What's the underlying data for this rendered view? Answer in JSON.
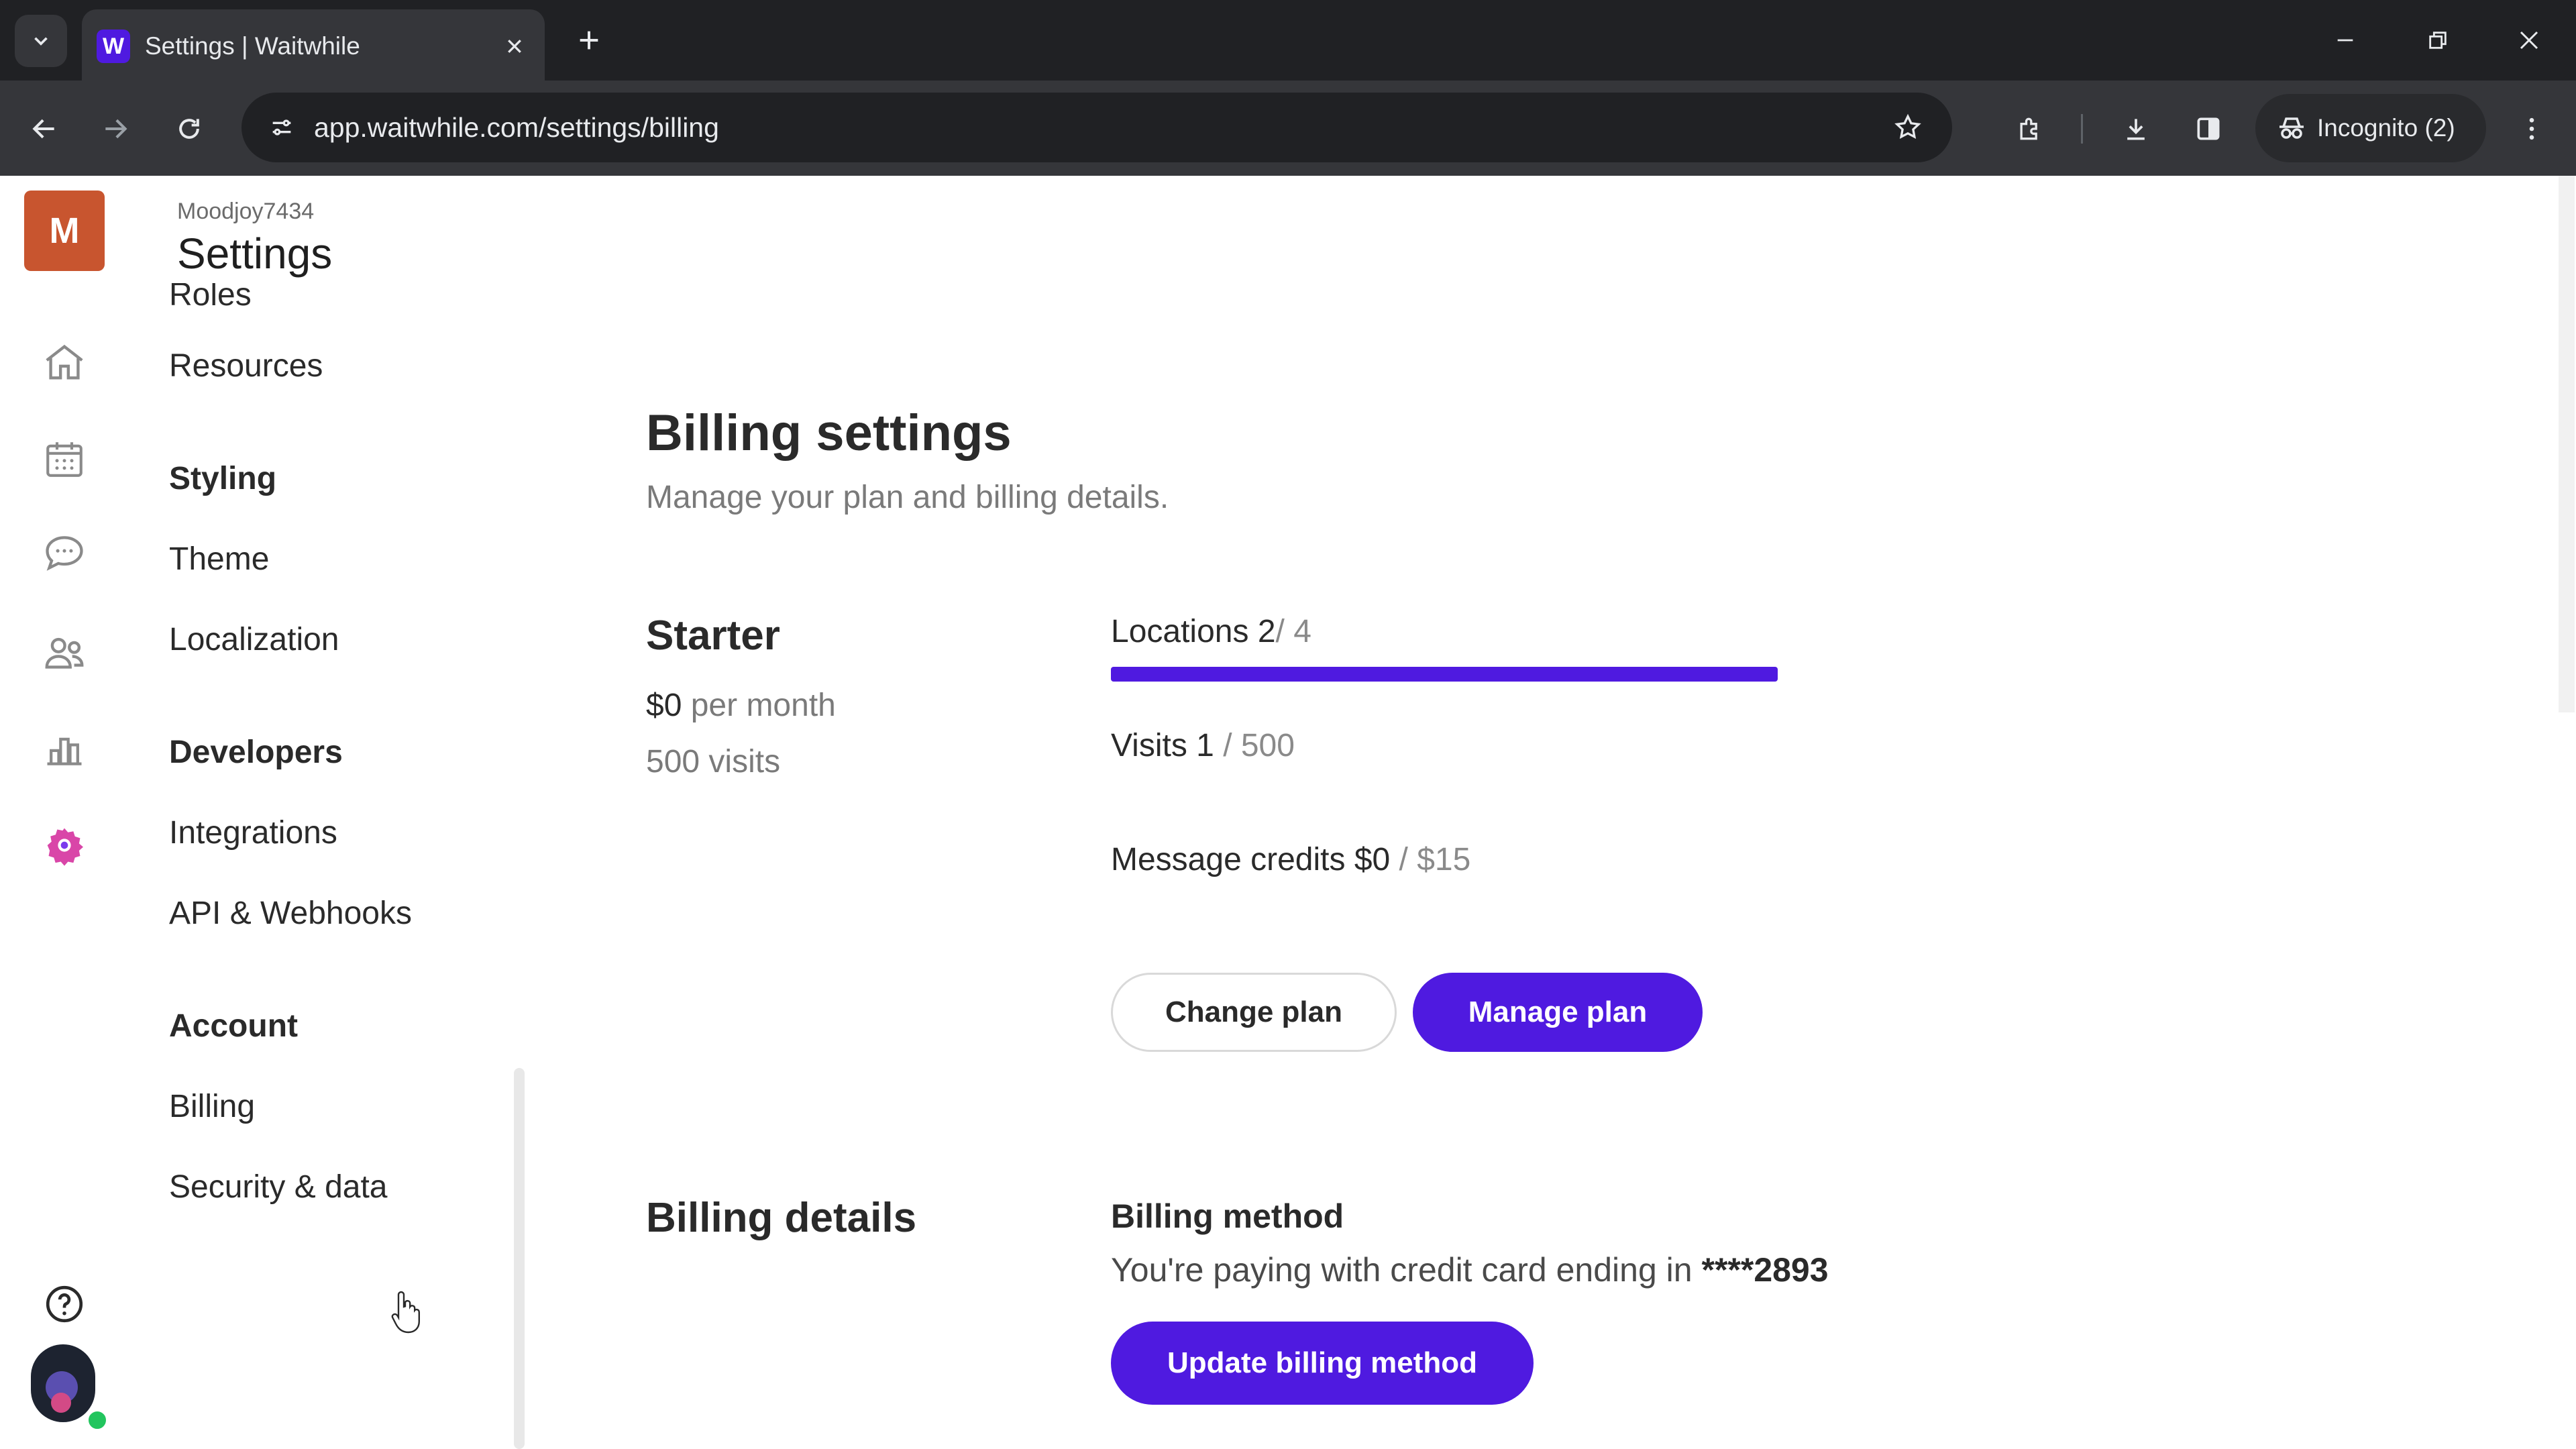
{
  "browser": {
    "tab_title": "Settings | Waitwhile",
    "favicon_letter": "W",
    "url": "app.waitwhile.com/settings/billing",
    "incognito_label": "Incognito (2)"
  },
  "rail": {
    "org_initial": "M",
    "icons": [
      "home-icon",
      "calendar-icon",
      "chat-icon",
      "users-icon",
      "analytics-icon",
      "settings-gear-icon",
      "help-icon"
    ]
  },
  "sidebar": {
    "org_name": "Moodjoy7434",
    "title": "Settings",
    "partial_item": "Roles",
    "resources": "Resources",
    "styling_section": "Styling",
    "theme": "Theme",
    "localization": "Localization",
    "developers_section": "Developers",
    "integrations": "Integrations",
    "api_webhooks": "API & Webhooks",
    "account_section": "Account",
    "billing": "Billing",
    "security_data": "Security & data"
  },
  "billing": {
    "title": "Billing settings",
    "subtitle": "Manage your plan and billing details.",
    "plan": {
      "name": "Starter",
      "price": "$0",
      "price_period": "per month",
      "visits": "500 visits"
    },
    "usage": {
      "locations_label": "Locations 2",
      "locations_total": "/ 4",
      "locations_progress": 0.5,
      "visits_label": "Visits 1",
      "visits_total": "/ 500",
      "credits_label": "Message credits $0",
      "credits_total": "/ $15"
    },
    "change_plan": "Change plan",
    "manage_plan": "Manage plan",
    "details_title": "Billing details",
    "method_title": "Billing method",
    "method_text": "You're paying with credit card ending in",
    "card_mask": "****2893",
    "update_method": "Update billing method"
  },
  "colors": {
    "primary": "#4f1ae0",
    "org_avatar": "#c8552f",
    "active_nav_icon": "#d946a8"
  }
}
